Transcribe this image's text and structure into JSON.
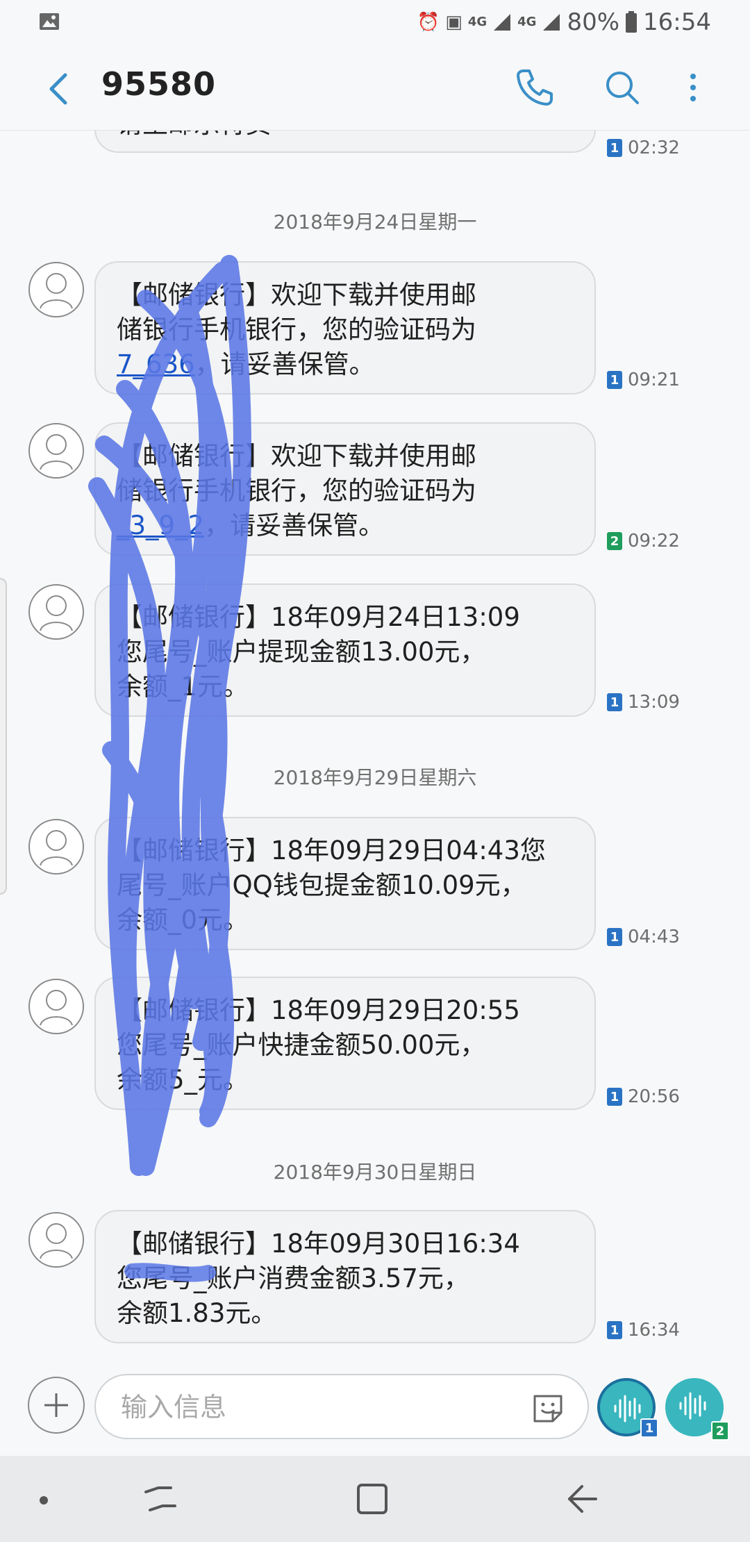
{
  "status_bar": {
    "battery": "80%",
    "time": "16:54",
    "network_1": "4G",
    "network_2": "4G"
  },
  "header": {
    "title": "95580",
    "back_icon": "back-arrow-icon",
    "call_icon": "phone-icon",
    "search_icon": "search-icon",
    "more_icon": "more-vertical-icon"
  },
  "messages": [
    {
      "text": "请至邮乐特卖",
      "sim": "1",
      "time": "02:32"
    },
    {
      "date": "2018年9月24日星期一"
    },
    {
      "text_before": "【邮储银行】欢迎下载并使用邮储银行手机银行，您的验证码为",
      "code": "7_636",
      "text_after": "，请妥善保管。",
      "sim": "1",
      "time": "09:21"
    },
    {
      "text_before": "【邮储银行】欢迎下载并使用邮储银行手机银行，您的验证码为",
      "code": "_3_9_2",
      "text_after": "，请妥善保管。",
      "sim": "2",
      "time": "09:22"
    },
    {
      "text": "【邮储银行】18年09月24日13:09您尾号_账户提现金额13.00元，余额_1元。",
      "sim": "1",
      "time": "13:09"
    },
    {
      "date": "2018年9月29日星期六"
    },
    {
      "text": "【邮储银行】18年09月29日04:43您尾号_账户QQ钱包提金额10.09元，余额_0元。",
      "sim": "1",
      "time": "04:43"
    },
    {
      "text": "【邮储银行】18年09月29日20:55您尾号_账户快捷金额50.00元，余额5_元。",
      "sim": "1",
      "time": "20:56"
    },
    {
      "date": "2018年9月30日星期日"
    },
    {
      "text": "【邮储银行】18年09月30日16:34您尾号_账户消费金额3.57元，余额1.83元。",
      "sim": "1",
      "time": "16:34"
    }
  ],
  "visible_lines": {
    "m0": [
      "请至邮乐特卖"
    ],
    "m1": [
      "【邮储银行】欢迎下载并使用邮",
      "储银行手机银行，您的验证码为",
      "7_636",
      "，请妥善保管。"
    ],
    "m2": [
      "【邮储银行】欢迎下载并使用邮",
      "储银行手机银行，您的验证码为",
      "_3_9_2",
      "，请妥善保管。"
    ],
    "m3": [
      "【邮储银行】18年09月24日13:09",
      "您尾号_账户提现金额13.00元，",
      "余额_1元。"
    ],
    "m4": [
      "【邮储银行】18年09月29日04:43您",
      "尾号_账户QQ钱包提金额10.09元，",
      "余额_0元。"
    ],
    "m5": [
      "【邮储银行】18年09月29日20:55",
      "您尾号_账户快捷金额50.00元，",
      "余额5_元。"
    ],
    "m6": [
      "【邮储银行】18年09月30日16:34",
      "您尾号_账户消费金额3.57元，",
      "余额1.83元。"
    ]
  },
  "input": {
    "placeholder": "输入信息",
    "value": ""
  },
  "voice_buttons": [
    {
      "icon": "voice-wave-icon",
      "sim": "1"
    },
    {
      "icon": "voice-wave-icon",
      "sim": "2"
    }
  ],
  "nav": {
    "recent_icon": "recents-icon",
    "home_icon": "home-icon",
    "back_icon": "back-icon"
  },
  "colors": {
    "accent": "#1a73c4",
    "sim1": "#2a73c4",
    "sim2": "#1f9d5d",
    "voice": "#39b6be",
    "scribble": "#5b78e6"
  }
}
